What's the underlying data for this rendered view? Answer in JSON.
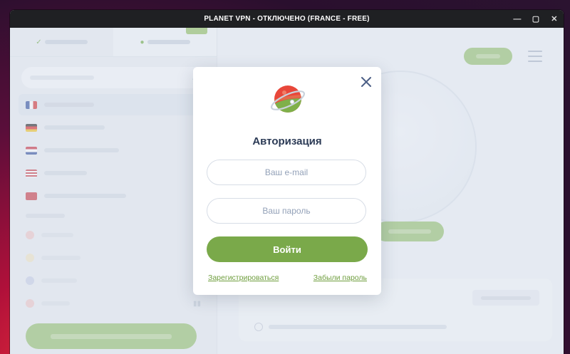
{
  "window": {
    "title": "PLANET VPN - ОТКЛЮЧЕНО (FRANCE - FREE)",
    "controls": {
      "minimize": "—",
      "maximize": "▢",
      "close": "✕"
    }
  },
  "modal": {
    "title": "Авторизация",
    "email_placeholder": "Ваш e-mail",
    "password_placeholder": "Ваш пароль",
    "submit_label": "Войти",
    "register_link": "Зарегистрироваться",
    "forgot_link": "Забыли пароль",
    "colors": {
      "accent": "#7aa94a",
      "title": "#2b3a55",
      "link": "#6f9e3e"
    },
    "icons": {
      "close": "close-icon",
      "logo": "planet-logo-icon"
    }
  }
}
